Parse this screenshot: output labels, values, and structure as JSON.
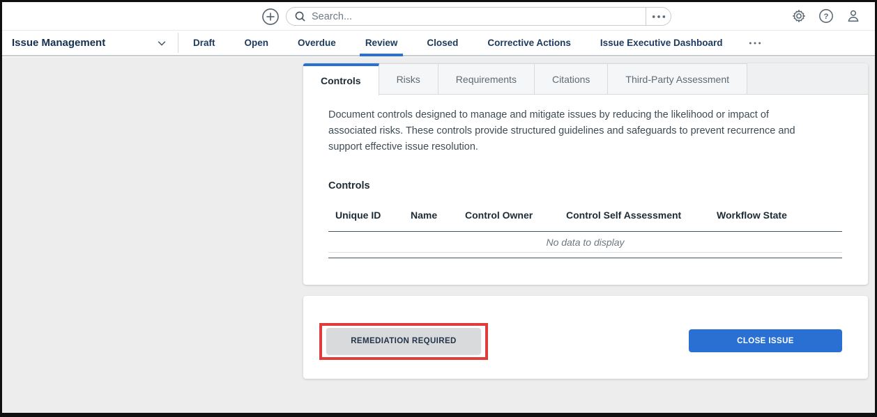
{
  "colors": {
    "accent_blue": "#2a70d2",
    "highlight_red": "#e13c3c",
    "page_bg": "#ededee",
    "nav_text": "#14304f"
  },
  "topbar": {
    "search": {
      "placeholder": "Search..."
    }
  },
  "icons": {
    "help_glyph": "?"
  },
  "navbar": {
    "app_title": "Issue Management",
    "tabs": [
      {
        "label": "Draft",
        "active": false
      },
      {
        "label": "Open",
        "active": false
      },
      {
        "label": "Overdue",
        "active": false
      },
      {
        "label": "Review",
        "active": true
      },
      {
        "label": "Closed",
        "active": false
      },
      {
        "label": "Corrective Actions",
        "active": false
      },
      {
        "label": "Issue Executive Dashboard",
        "active": false
      }
    ]
  },
  "content": {
    "tabs": [
      {
        "label": "Controls",
        "active": true
      },
      {
        "label": "Risks",
        "active": false
      },
      {
        "label": "Requirements",
        "active": false
      },
      {
        "label": "Citations",
        "active": false
      },
      {
        "label": "Third-Party Assessment",
        "active": false
      }
    ],
    "description": "Document controls designed to manage and mitigate issues by reducing the likelihood or impact of associated risks. These controls provide structured guidelines and safeguards to prevent recurrence and support effective issue resolution.",
    "section_title": "Controls",
    "table": {
      "columns": [
        "Unique ID",
        "Name",
        "Control Owner",
        "Control Self Assessment",
        "Workflow State"
      ],
      "rows": [],
      "empty_message": "No data to display"
    }
  },
  "actions": {
    "remediation_label": "REMEDIATION REQUIRED",
    "close_label": "CLOSE ISSUE"
  }
}
